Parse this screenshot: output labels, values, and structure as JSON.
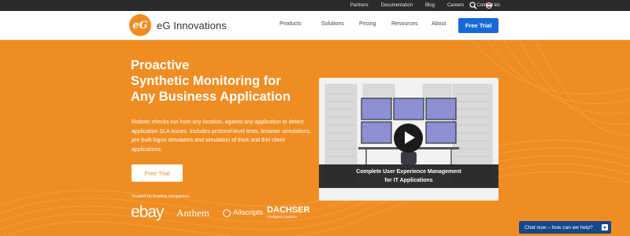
{
  "topbar": {
    "links": [
      "Partners",
      "Documentation",
      "Blog",
      "Careers",
      "Contact Us"
    ],
    "search_icon": "search-icon",
    "language_icon": "us-flag-icon"
  },
  "nav": {
    "logo_text": "eG Innovations",
    "logo_mark": "eG",
    "menu": [
      "Products",
      "Solutions",
      "Pricing",
      "Resources",
      "About"
    ],
    "trial_label": "Free Trial"
  },
  "hero": {
    "headline": [
      "Proactive",
      "Synthetic Monitoring for",
      "Any Business Application"
    ],
    "description": "Robotic checks run from any location, against any application to detect application SLA issues. Includes protocol-level tests, browser simulations, pre-built logon simulators and simulation of thick and thin client applications.",
    "trial_label": "Free Trial",
    "trusted_label": "Trusted by leading companies",
    "clients": {
      "ebay": "ebay",
      "anthem": "Anthem",
      "allscripts": "Allscripts",
      "dachser": "DACHSER",
      "dachser_sub": "Intelligent Logistics"
    }
  },
  "video": {
    "caption_line1": "Complete User Experience Management",
    "caption_line2": "for IT Applications",
    "play_icon": "play-icon"
  },
  "chat": {
    "label": "Chat now – how can we help?",
    "toggle_icon": "chevron-down-icon"
  },
  "colors": {
    "brand_orange": "#ef8d22",
    "primary_blue": "#1869d6",
    "chat_blue": "#14478c",
    "topbar": "#2b2b2b"
  }
}
